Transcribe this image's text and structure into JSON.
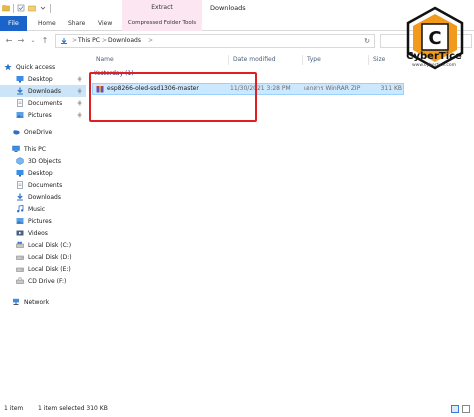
{
  "window": {
    "title": "Downloads",
    "context_tab": "Extract",
    "context_subtab": "Compressed Folder Tools"
  },
  "ribbon": {
    "tabs": [
      "File",
      "Home",
      "Share",
      "View"
    ]
  },
  "address": {
    "crumbs": [
      "This PC",
      "Downloads"
    ],
    "separator": ">"
  },
  "navpane": {
    "items": [
      {
        "label": "Quick access",
        "icon": "star-icon",
        "pinned": false
      },
      {
        "label": "Desktop",
        "icon": "desktop-icon",
        "pinned": true
      },
      {
        "label": "Downloads",
        "icon": "download-icon",
        "pinned": true,
        "selected": true
      },
      {
        "label": "Documents",
        "icon": "documents-icon",
        "pinned": true
      },
      {
        "label": "Pictures",
        "icon": "pictures-icon",
        "pinned": true
      },
      {
        "label": "OneDrive",
        "icon": "cloud-icon",
        "pinned": false
      },
      {
        "label": "This PC",
        "icon": "computer-icon",
        "pinned": false
      },
      {
        "label": "3D Objects",
        "icon": "cube-icon",
        "pinned": false
      },
      {
        "label": "Desktop",
        "icon": "desktop-icon",
        "pinned": false
      },
      {
        "label": "Documents",
        "icon": "documents-icon",
        "pinned": false
      },
      {
        "label": "Downloads",
        "icon": "download-icon",
        "pinned": false
      },
      {
        "label": "Music",
        "icon": "music-icon",
        "pinned": false
      },
      {
        "label": "Pictures",
        "icon": "pictures-icon",
        "pinned": false
      },
      {
        "label": "Videos",
        "icon": "video-icon",
        "pinned": false
      },
      {
        "label": "Local Disk (C:)",
        "icon": "drive-icon",
        "pinned": false
      },
      {
        "label": "Local Disk (D:)",
        "icon": "drive-icon",
        "pinned": false
      },
      {
        "label": "Local Disk (E:)",
        "icon": "drive-icon",
        "pinned": false
      },
      {
        "label": "CD Drive (F:)",
        "icon": "cd-drive-icon",
        "pinned": false
      },
      {
        "label": "Network",
        "icon": "network-icon",
        "pinned": false
      }
    ]
  },
  "list": {
    "columns": [
      "Name",
      "Date modified",
      "Type",
      "Size"
    ],
    "group_label": "Yesterday (1)",
    "files": [
      {
        "name": "esp8266-oled-ssd1306-master",
        "date": "11/30/2021 3:28 PM",
        "type": "เอกสาร WinRAR ZIP",
        "size": "311 KB"
      }
    ]
  },
  "logo": {
    "brand": "CyberTice",
    "url": "www.cybertice.com",
    "letter": "C"
  },
  "status": {
    "items_count": "1 item",
    "selection": "1 item selected  310 KB"
  },
  "colors": {
    "accent": "#1a63c8",
    "selection": "#cce8ff",
    "highlight_box": "#e02020",
    "context_tab": "#fbe6f1",
    "logo_orange": "#f29a1c"
  }
}
